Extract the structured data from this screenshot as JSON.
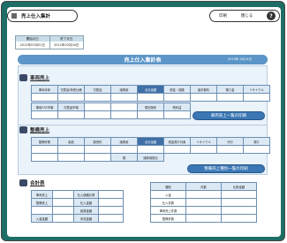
{
  "window": {
    "title": "売上仕入集計"
  },
  "header_buttons": {
    "print": "印刷",
    "close": "閉じる",
    "help": "?"
  },
  "period": {
    "start_label": "開始月日",
    "end_label": "終了月日",
    "start_value": "2012年03月01日",
    "end_value": "2012年02月04日"
  },
  "main_header": {
    "title": "売上仕入集計表",
    "date": "2013年 5月14日"
  },
  "vehicle_sales": {
    "title": "車両売上",
    "header_row": [
      "車両本体",
      "付属品/特別仕様",
      "付属品",
      "諸費用",
      "合計金額",
      "税金・保険",
      "諸手数料",
      "預り金",
      "リサイクル"
    ],
    "row2": [
      "車両333市場",
      "付属品市場",
      "",
      "",
      "現在販売",
      "残利益"
    ],
    "print_label": "車両売上一覧の印刷"
  },
  "service_sales": {
    "title": "整備売上",
    "header_row": [
      "整備作業",
      "部品",
      "販売料",
      "諸費用",
      "合計金額",
      "税金預り対象",
      "リサイクル",
      "代行",
      "預り"
    ],
    "row2": [
      "",
      "",
      "",
      "預",
      "諸費用提出"
    ],
    "print_label": "整備売上種別一覧の印刷"
  },
  "totals": {
    "title": "合計表",
    "left_rows": [
      {
        "label": "車両売上",
        "sub": "仕入価格計算"
      },
      {
        "label": "整備売上",
        "sub": "仕入金額"
      },
      {
        "label": "",
        "sub": "経費金額"
      },
      {
        "label": "入金金額",
        "sub": "未収金額"
      }
    ],
    "right_header": [
      "種別",
      "件数",
      "仕掛金額"
    ],
    "right_rows": [
      "入金",
      "仕入件数",
      "車両売上件数",
      "整備件数"
    ]
  }
}
